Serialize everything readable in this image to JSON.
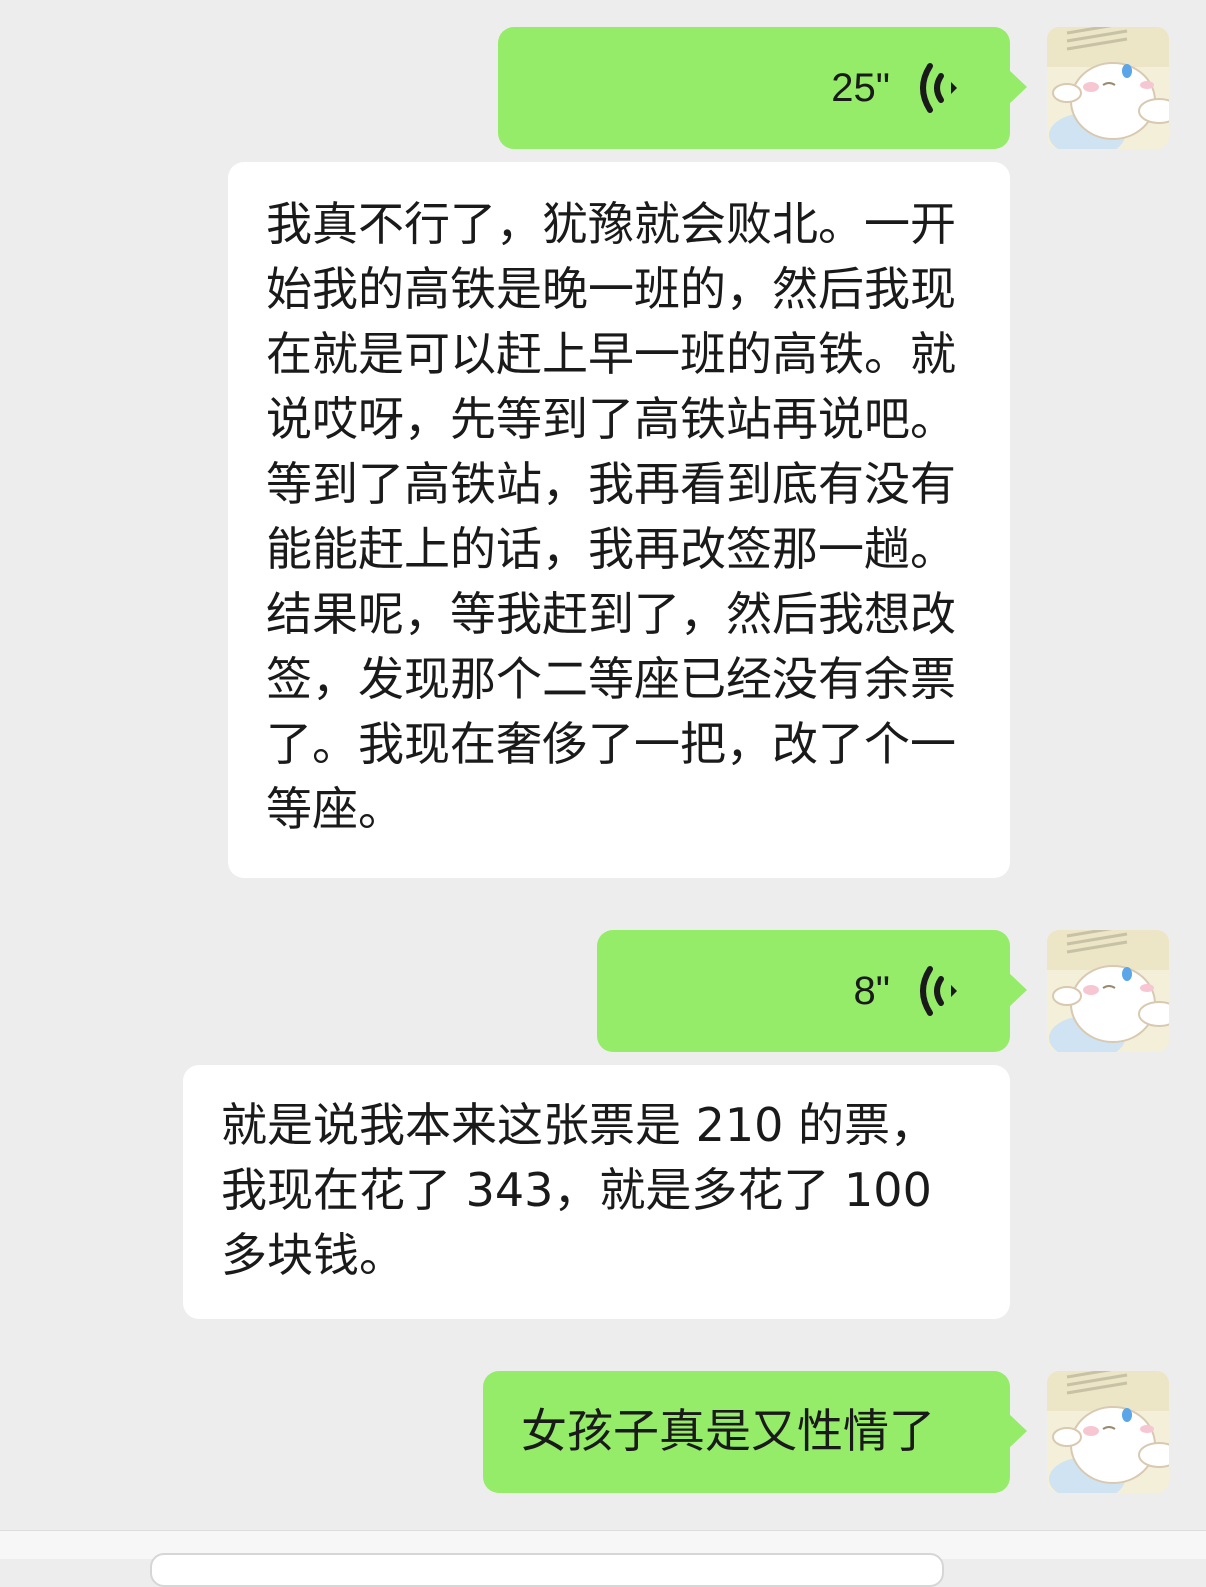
{
  "messages": [
    {
      "type": "voice",
      "side": "right",
      "duration": "25\""
    },
    {
      "type": "text",
      "side": "right",
      "bubble": "white",
      "text": "我真不行了，犹豫就会败北。一开始我的高铁是晚一班的，然后我现在就是可以赶上早一班的高铁。就说哎呀，先等到了高铁站再说吧。等到了高铁站，我再看到底有没有能能赶上的话，我再改签那一趟。结果呢，等我赶到了，然后我想改签，发现那个二等座已经没有余票了。我现在奢侈了一把，改了个一等座。"
    },
    {
      "type": "voice",
      "side": "right",
      "duration": "8\""
    },
    {
      "type": "text",
      "side": "right",
      "bubble": "white",
      "text": "就是说我本来这张票是 210 的票，我现在花了 343，就是多花了 100 多块钱。"
    },
    {
      "type": "text",
      "side": "right",
      "bubble": "green",
      "text": "女孩子真是又性情了"
    }
  ],
  "icons": {
    "voice": "voice-wave-icon",
    "avatar": "avatar-cinnamoroll"
  },
  "colors": {
    "background": "#ededed",
    "green_bubble": "#95ec69",
    "white_bubble": "#ffffff"
  }
}
